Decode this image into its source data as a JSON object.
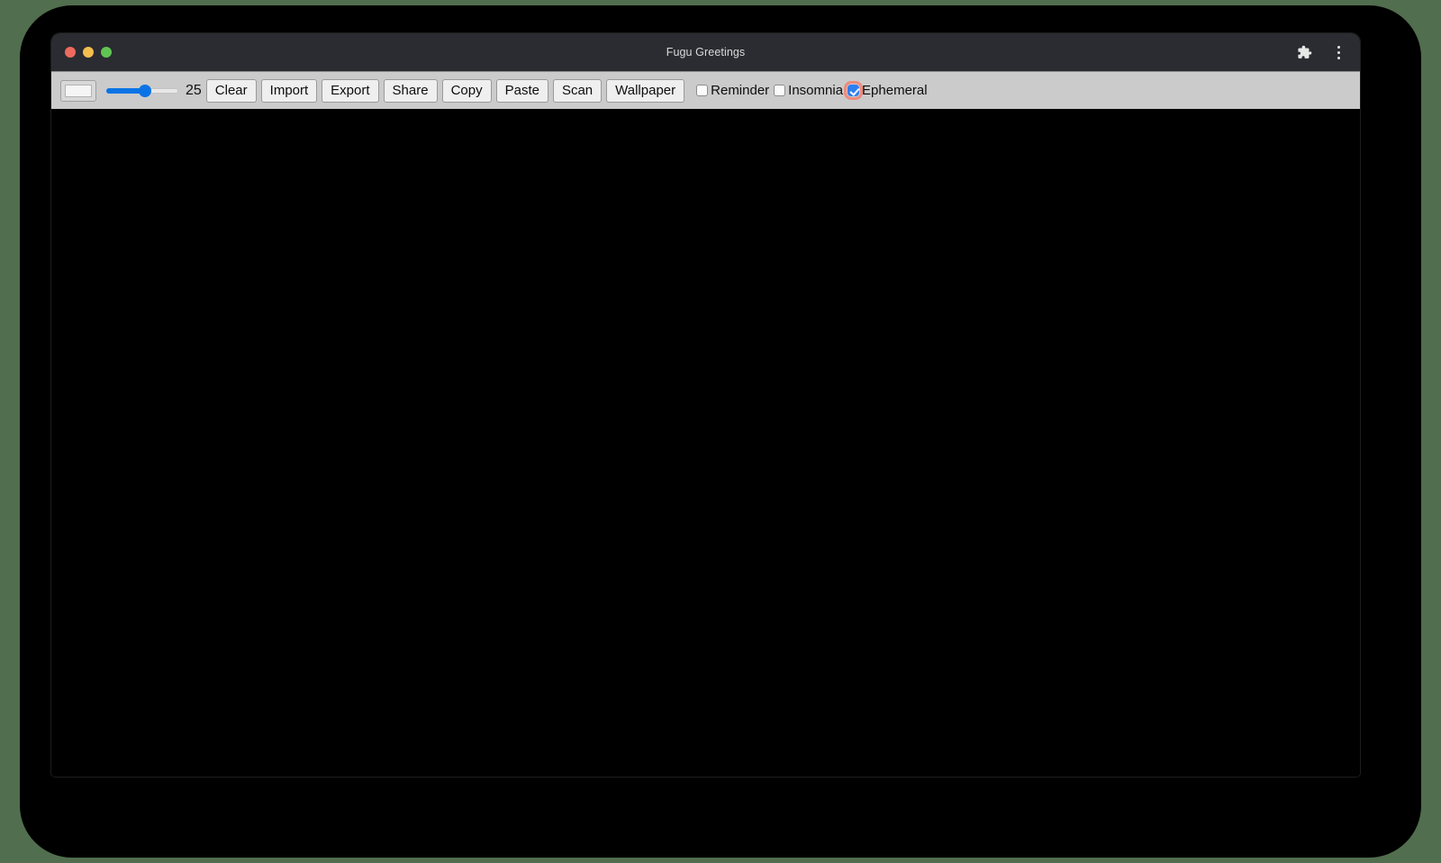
{
  "window": {
    "title": "Fugu Greetings",
    "traffic_lights": [
      {
        "name": "close",
        "color": "#ed6a5e"
      },
      {
        "name": "minimize",
        "color": "#f4bf4f"
      },
      {
        "name": "maximize",
        "color": "#61c554"
      }
    ],
    "right_icons": [
      {
        "name": "extensions-puzzle-icon"
      },
      {
        "name": "browser-menu-kebab-icon"
      }
    ]
  },
  "toolbar": {
    "color_picker": {
      "name": "color-picker",
      "value": "#ffffff"
    },
    "line_width": {
      "name": "line-width-slider",
      "value": "25",
      "min": "1",
      "max": "50",
      "percent": 50
    },
    "buttons": [
      {
        "label": "Clear"
      },
      {
        "label": "Import"
      },
      {
        "label": "Export"
      },
      {
        "label": "Share"
      },
      {
        "label": "Copy"
      },
      {
        "label": "Paste"
      },
      {
        "label": "Scan"
      },
      {
        "label": "Wallpaper"
      }
    ],
    "checkboxes": [
      {
        "label": "Reminder",
        "checked": false,
        "focused": false
      },
      {
        "label": "Insomnia",
        "checked": false,
        "focused": false
      },
      {
        "label": "Ephemeral",
        "checked": true,
        "focused": true
      }
    ]
  },
  "canvas": {
    "name": "drawing-canvas",
    "background": "#000000"
  },
  "colors": {
    "desktop_background": "#516e4e",
    "title_bar": "#2a2c31",
    "toolbar": "#cbcbcb",
    "accent_blue": "#2f7ef0",
    "focus_ring": "#ef8a7c"
  }
}
